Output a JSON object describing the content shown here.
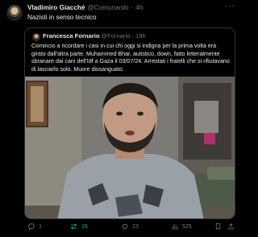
{
  "tweet": {
    "author_name": "Vladimiro Giacché",
    "author_handle": "@Comunardo",
    "time": "4h",
    "text": "Nazisti in senso tecnico",
    "more_icon": "more-horizontal-icon"
  },
  "quote": {
    "author_name": "Francesca Fornario",
    "author_handle": "@Fornario",
    "time": "19h",
    "text": "Comincio a ricordare i casi in cui chi oggi si indigna per la prima volta era girato dall'altra parte. Muhammed Bhar, autistico, down, fatto letteralmente sbranare dai cani dell'Idf a Gaza il 03/07/24. Arrestati i fratelli che si rifiutavano di lasciarlo solo. Muore dissanguato."
  },
  "actions": {
    "replies": "1",
    "reposts": "16",
    "likes": "23",
    "views": "525",
    "repost_color": "#00ba7c"
  }
}
